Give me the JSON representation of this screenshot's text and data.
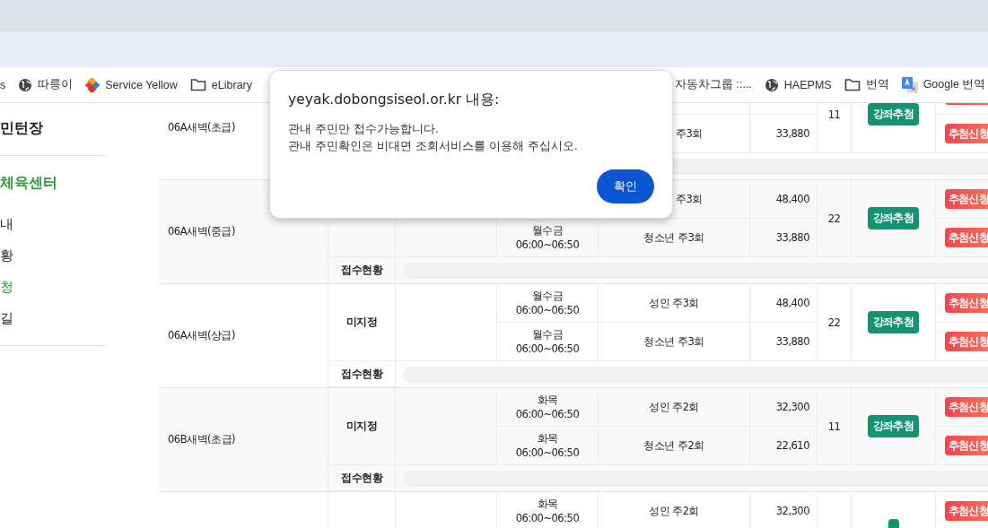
{
  "bookmarks": [
    {
      "kind": "text",
      "label": "s"
    },
    {
      "kind": "globe",
      "label": "따릉이"
    },
    {
      "kind": "tiles",
      "label": "Service Yellow"
    },
    {
      "kind": "folder",
      "label": "eLibrary"
    },
    {
      "kind": "text",
      "label": "자동차그룹 ::..."
    },
    {
      "kind": "globe",
      "label": "HAEPMS"
    },
    {
      "kind": "folder",
      "label": "번역"
    },
    {
      "kind": "translate",
      "label": "Google 번역"
    }
  ],
  "sidebar": {
    "items": [
      {
        "label": "민턴장",
        "kind": "heading",
        "selected": false
      },
      {
        "label": "체육센터",
        "kind": "heading",
        "selected": true
      },
      {
        "label": "내",
        "kind": "link",
        "selected": false
      },
      {
        "label": "황",
        "kind": "link",
        "selected": false
      },
      {
        "label": "청",
        "kind": "link",
        "selected": true
      },
      {
        "label": "길",
        "kind": "link",
        "selected": false
      }
    ]
  },
  "courses": [
    {
      "name": "06A새벽(초급)",
      "count": "11",
      "lecture": "강좌추첨",
      "sessions": [
        {
          "kind": "covered"
        },
        {
          "kind": "row",
          "target": "주3회",
          "target_cut": true,
          "price": "33,880",
          "apply": "추첨신청"
        }
      ]
    },
    {
      "name": "06A새벽(중급)",
      "count": "22",
      "lecture": "강좌추첨",
      "receipt": "접수현황",
      "sessions": [
        {
          "kind": "row",
          "target": "주3회",
          "target_cut": true,
          "price": "48,400",
          "apply": "추첨신청"
        },
        {
          "kind": "row",
          "day": "월수금",
          "time": "06:00~06:50",
          "target": "청소년 주3회",
          "price": "33,880",
          "apply": "추첨신청"
        }
      ]
    },
    {
      "name": "06A새벽(상급)",
      "status": "미지정",
      "count": "22",
      "lecture": "강좌추첨",
      "receipt": "접수현황",
      "sessions": [
        {
          "kind": "row",
          "day": "월수금",
          "time": "06:00~06:50",
          "target": "성인 주3회",
          "price": "48,400",
          "apply": "추첨신청"
        },
        {
          "kind": "row",
          "day": "월수금",
          "time": "06:00~06:50",
          "target": "청소년 주3회",
          "price": "33,880",
          "apply": "추첨신청"
        }
      ]
    },
    {
      "name": "06B새벽(초급)",
      "status": "미지정",
      "count": "11",
      "lecture": "강좌추첨",
      "receipt": "접수현황",
      "sessions": [
        {
          "kind": "row",
          "day": "화목",
          "time": "06:00~06:50",
          "target": "성인 주2회",
          "price": "32,300",
          "apply": "추첨신청"
        },
        {
          "kind": "row",
          "day": "화목",
          "time": "06:00~06:50",
          "target": "청소년 주2회",
          "price": "22,610",
          "apply": "추첨신청"
        }
      ]
    },
    {
      "sessions": [
        {
          "kind": "row",
          "day": "화목",
          "time": "06:00~06:50",
          "target": "성인 주2회",
          "price": "32,300",
          "apply": "추첨신청"
        }
      ]
    }
  ],
  "dialog": {
    "title": "yeyak.dobongsiseol.or.kr 내용:",
    "message": [
      "관내 주민만 접수가능합니다.",
      "관내 주민확인은 비대면 조회서비스를 이용해 주십시오."
    ],
    "button": "확인"
  }
}
